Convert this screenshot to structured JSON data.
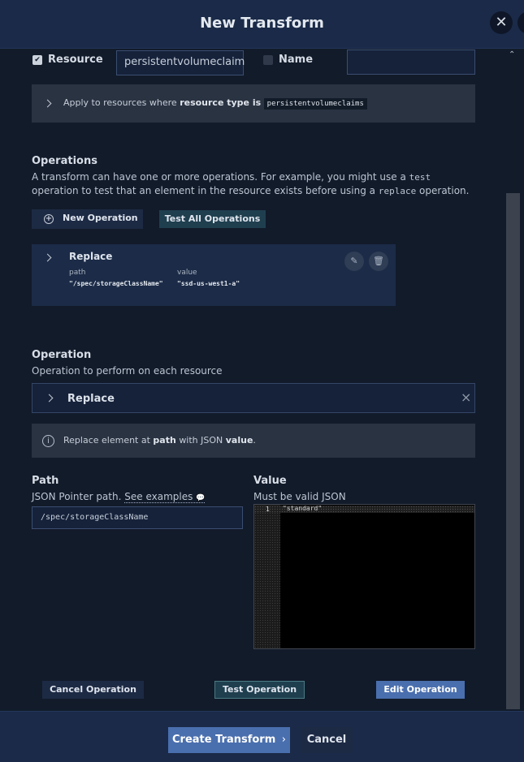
{
  "dialog": {
    "title": "New Transform",
    "close_glyph": "✕"
  },
  "resource_row": {
    "resource_label": "Resource",
    "resource_value": "persistentvolumeclaim",
    "resource_checked": true,
    "name_label": "Name",
    "name_value": "",
    "name_checked": false
  },
  "rule_summary": {
    "prefix": "Apply to resources where",
    "key": "resource type is",
    "value": "persistentvolumeclaims"
  },
  "operations": {
    "title": "Operations",
    "desc_part1": "A transform can have one or more operations. For example, you might use a",
    "desc_code1": "test",
    "desc_part2": "operation to test that an element in the resource exists before using a",
    "desc_code2": "replace",
    "desc_part3": "operation.",
    "new_button": "New Operation",
    "test_all_button": "Test All Operations",
    "items": [
      {
        "name": "Replace",
        "path_label": "path",
        "path_value": "\"/spec/storageClassName\"",
        "value_label": "value",
        "value_value": "\"ssd-us-west1-a\""
      }
    ]
  },
  "operation_form": {
    "title": "Operation",
    "subtitle": "Operation to perform on each resource",
    "selected": "Replace",
    "info_prefix": "Replace element at",
    "info_path": "path",
    "info_mid": "with JSON",
    "info_value": "value",
    "info_suffix": ".",
    "path_title": "Path",
    "path_hint": "JSON Pointer path.",
    "path_link": "See examples",
    "path_value": "/spec/storageClassName",
    "value_title": "Value",
    "value_hint": "Must be valid JSON",
    "editor_line_number": "1",
    "editor_text": "\"standard\"",
    "cancel_button": "Cancel Operation",
    "test_button": "Test Operation",
    "edit_button": "Edit Operation"
  },
  "footer": {
    "create_button": "Create Transform",
    "create_chevron": "›",
    "cancel_button": "Cancel"
  },
  "icons": {
    "check": "✔",
    "plus": "+",
    "info": "i",
    "clear": "×",
    "edit": "✎",
    "trash": "🗑",
    "scroll_up": "⌃",
    "comment": "💬"
  },
  "colors": {
    "background": "#121b2a",
    "header": "#1a2a48",
    "accent_blue": "#4a6fae",
    "teal": "#1f3f4f"
  }
}
